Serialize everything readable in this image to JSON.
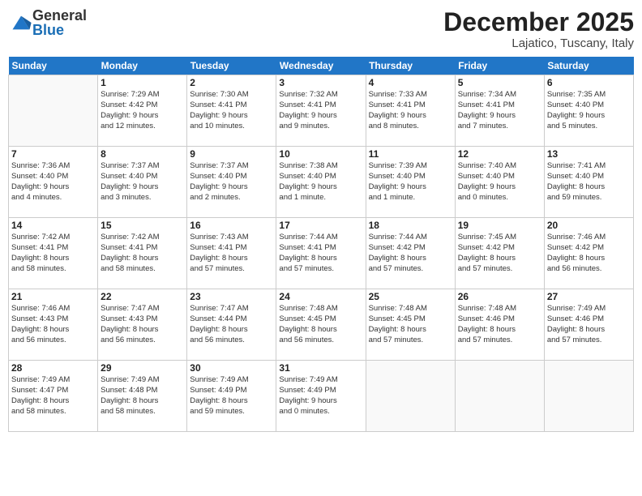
{
  "logo": {
    "general": "General",
    "blue": "Blue"
  },
  "calendar": {
    "title": "December 2025",
    "subtitle": "Lajatico, Tuscany, Italy"
  },
  "days_of_week": [
    "Sunday",
    "Monday",
    "Tuesday",
    "Wednesday",
    "Thursday",
    "Friday",
    "Saturday"
  ],
  "weeks": [
    [
      {
        "day": "",
        "info": ""
      },
      {
        "day": "1",
        "info": "Sunrise: 7:29 AM\nSunset: 4:42 PM\nDaylight: 9 hours\nand 12 minutes."
      },
      {
        "day": "2",
        "info": "Sunrise: 7:30 AM\nSunset: 4:41 PM\nDaylight: 9 hours\nand 10 minutes."
      },
      {
        "day": "3",
        "info": "Sunrise: 7:32 AM\nSunset: 4:41 PM\nDaylight: 9 hours\nand 9 minutes."
      },
      {
        "day": "4",
        "info": "Sunrise: 7:33 AM\nSunset: 4:41 PM\nDaylight: 9 hours\nand 8 minutes."
      },
      {
        "day": "5",
        "info": "Sunrise: 7:34 AM\nSunset: 4:41 PM\nDaylight: 9 hours\nand 7 minutes."
      },
      {
        "day": "6",
        "info": "Sunrise: 7:35 AM\nSunset: 4:40 PM\nDaylight: 9 hours\nand 5 minutes."
      }
    ],
    [
      {
        "day": "7",
        "info": "Sunrise: 7:36 AM\nSunset: 4:40 PM\nDaylight: 9 hours\nand 4 minutes."
      },
      {
        "day": "8",
        "info": "Sunrise: 7:37 AM\nSunset: 4:40 PM\nDaylight: 9 hours\nand 3 minutes."
      },
      {
        "day": "9",
        "info": "Sunrise: 7:37 AM\nSunset: 4:40 PM\nDaylight: 9 hours\nand 2 minutes."
      },
      {
        "day": "10",
        "info": "Sunrise: 7:38 AM\nSunset: 4:40 PM\nDaylight: 9 hours\nand 1 minute."
      },
      {
        "day": "11",
        "info": "Sunrise: 7:39 AM\nSunset: 4:40 PM\nDaylight: 9 hours\nand 1 minute."
      },
      {
        "day": "12",
        "info": "Sunrise: 7:40 AM\nSunset: 4:40 PM\nDaylight: 9 hours\nand 0 minutes."
      },
      {
        "day": "13",
        "info": "Sunrise: 7:41 AM\nSunset: 4:40 PM\nDaylight: 8 hours\nand 59 minutes."
      }
    ],
    [
      {
        "day": "14",
        "info": "Sunrise: 7:42 AM\nSunset: 4:41 PM\nDaylight: 8 hours\nand 58 minutes."
      },
      {
        "day": "15",
        "info": "Sunrise: 7:42 AM\nSunset: 4:41 PM\nDaylight: 8 hours\nand 58 minutes."
      },
      {
        "day": "16",
        "info": "Sunrise: 7:43 AM\nSunset: 4:41 PM\nDaylight: 8 hours\nand 57 minutes."
      },
      {
        "day": "17",
        "info": "Sunrise: 7:44 AM\nSunset: 4:41 PM\nDaylight: 8 hours\nand 57 minutes."
      },
      {
        "day": "18",
        "info": "Sunrise: 7:44 AM\nSunset: 4:42 PM\nDaylight: 8 hours\nand 57 minutes."
      },
      {
        "day": "19",
        "info": "Sunrise: 7:45 AM\nSunset: 4:42 PM\nDaylight: 8 hours\nand 57 minutes."
      },
      {
        "day": "20",
        "info": "Sunrise: 7:46 AM\nSunset: 4:42 PM\nDaylight: 8 hours\nand 56 minutes."
      }
    ],
    [
      {
        "day": "21",
        "info": "Sunrise: 7:46 AM\nSunset: 4:43 PM\nDaylight: 8 hours\nand 56 minutes."
      },
      {
        "day": "22",
        "info": "Sunrise: 7:47 AM\nSunset: 4:43 PM\nDaylight: 8 hours\nand 56 minutes."
      },
      {
        "day": "23",
        "info": "Sunrise: 7:47 AM\nSunset: 4:44 PM\nDaylight: 8 hours\nand 56 minutes."
      },
      {
        "day": "24",
        "info": "Sunrise: 7:48 AM\nSunset: 4:45 PM\nDaylight: 8 hours\nand 56 minutes."
      },
      {
        "day": "25",
        "info": "Sunrise: 7:48 AM\nSunset: 4:45 PM\nDaylight: 8 hours\nand 57 minutes."
      },
      {
        "day": "26",
        "info": "Sunrise: 7:48 AM\nSunset: 4:46 PM\nDaylight: 8 hours\nand 57 minutes."
      },
      {
        "day": "27",
        "info": "Sunrise: 7:49 AM\nSunset: 4:46 PM\nDaylight: 8 hours\nand 57 minutes."
      }
    ],
    [
      {
        "day": "28",
        "info": "Sunrise: 7:49 AM\nSunset: 4:47 PM\nDaylight: 8 hours\nand 58 minutes."
      },
      {
        "day": "29",
        "info": "Sunrise: 7:49 AM\nSunset: 4:48 PM\nDaylight: 8 hours\nand 58 minutes."
      },
      {
        "day": "30",
        "info": "Sunrise: 7:49 AM\nSunset: 4:49 PM\nDaylight: 8 hours\nand 59 minutes."
      },
      {
        "day": "31",
        "info": "Sunrise: 7:49 AM\nSunset: 4:49 PM\nDaylight: 9 hours\nand 0 minutes."
      },
      {
        "day": "",
        "info": ""
      },
      {
        "day": "",
        "info": ""
      },
      {
        "day": "",
        "info": ""
      }
    ]
  ]
}
